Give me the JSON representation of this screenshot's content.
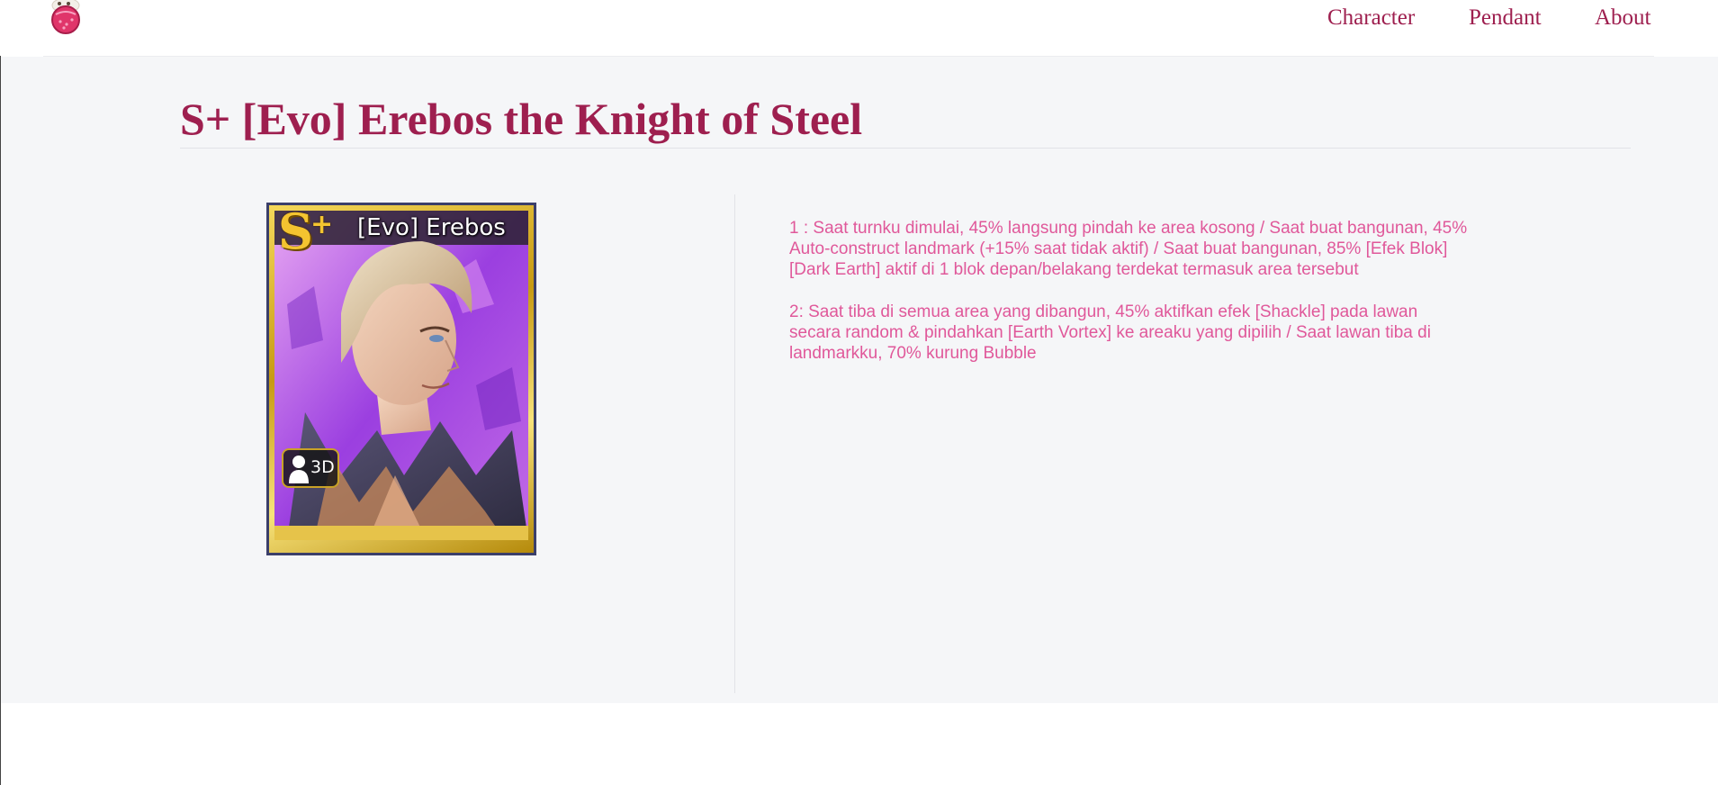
{
  "nav": {
    "logo_icon": "lychee-mascot-icon",
    "items": [
      {
        "label": "Character"
      },
      {
        "label": "Pendant"
      },
      {
        "label": "About"
      }
    ]
  },
  "page": {
    "title": "S+ [Evo] Erebos the Knight of Steel"
  },
  "card": {
    "rank": "S",
    "rank_plus": "+",
    "name": "[Evo] Erebos",
    "badge": "3D",
    "badge_icon": "person-silhouette-icon"
  },
  "skills": [
    {
      "text": "1 : Saat turnku dimulai, 45% langsung pindah ke area kosong / Saat buat bangunan, 45% Auto-construct landmark (+15% saat tidak aktif) / Saat buat bangunan, 85% [Efek Blok] [Dark Earth] aktif di 1 blok depan/belakang terdekat termasuk area tersebut"
    },
    {
      "text": "2: Saat tiba di semua area yang dibangun, 45% aktifkan efek [Shackle] pada lawan secara random & pindahkan [Earth Vortex] ke areaku yang dipilih / Saat lawan tiba di landmarkku, 70% kurung Bubble"
    }
  ],
  "colors": {
    "accent": "#9e1f4f",
    "skill_text": "#e0589a",
    "background": "#f5f6f8"
  }
}
